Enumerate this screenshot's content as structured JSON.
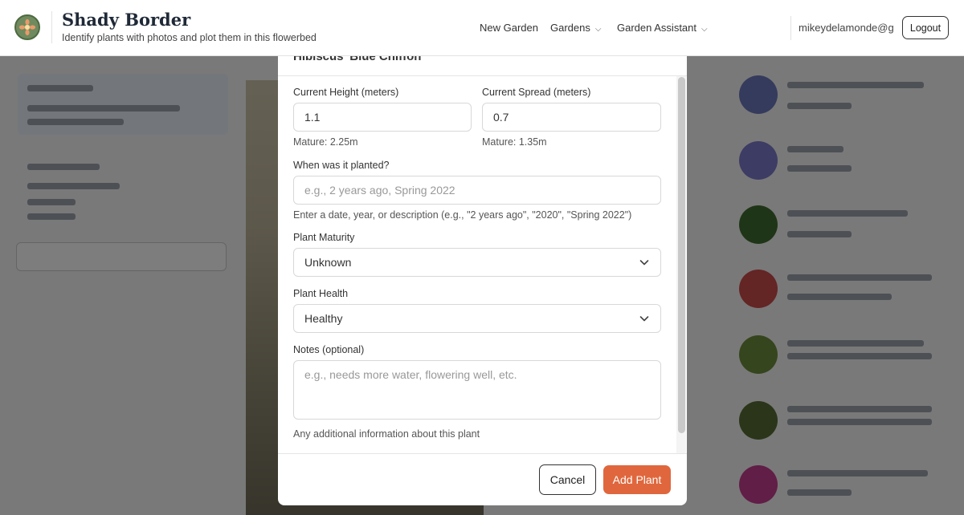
{
  "header": {
    "title": "Shady Border",
    "subtitle": "Identify plants with photos and plot them in this flowerbed",
    "nav": {
      "new_garden": "New Garden",
      "gardens": "Gardens",
      "garden_assistant": "Garden Assistant"
    },
    "user_email": "mikeydelamonde@g...",
    "logout_label": "Logout"
  },
  "modal": {
    "title": "Hibiscus 'Blue Chiffon'",
    "height": {
      "label": "Current Height (meters)",
      "value": "1.1",
      "mature": "Mature: 2.25m"
    },
    "spread": {
      "label": "Current Spread (meters)",
      "value": "0.7",
      "mature": "Mature: 1.35m"
    },
    "planted": {
      "label": "When was it planted?",
      "placeholder": "e.g., 2 years ago, Spring 2022",
      "hint": "Enter a date, year, or description (e.g., \"2 years ago\", \"2020\", \"Spring 2022\")"
    },
    "maturity": {
      "label": "Plant Maturity",
      "selected": "Unknown"
    },
    "health": {
      "label": "Plant Health",
      "selected": "Healthy"
    },
    "notes": {
      "label": "Notes (optional)",
      "placeholder": "e.g., needs more water, flowering well, etc.",
      "hint": "Any additional information about this plant"
    },
    "cancel_label": "Cancel",
    "add_label": "Add Plant"
  },
  "colors": {
    "accent": "#e0673d",
    "overlay": "rgba(0,0,0,0.5)"
  },
  "icons": [
    "logo-icon",
    "chevron-down-icon"
  ]
}
